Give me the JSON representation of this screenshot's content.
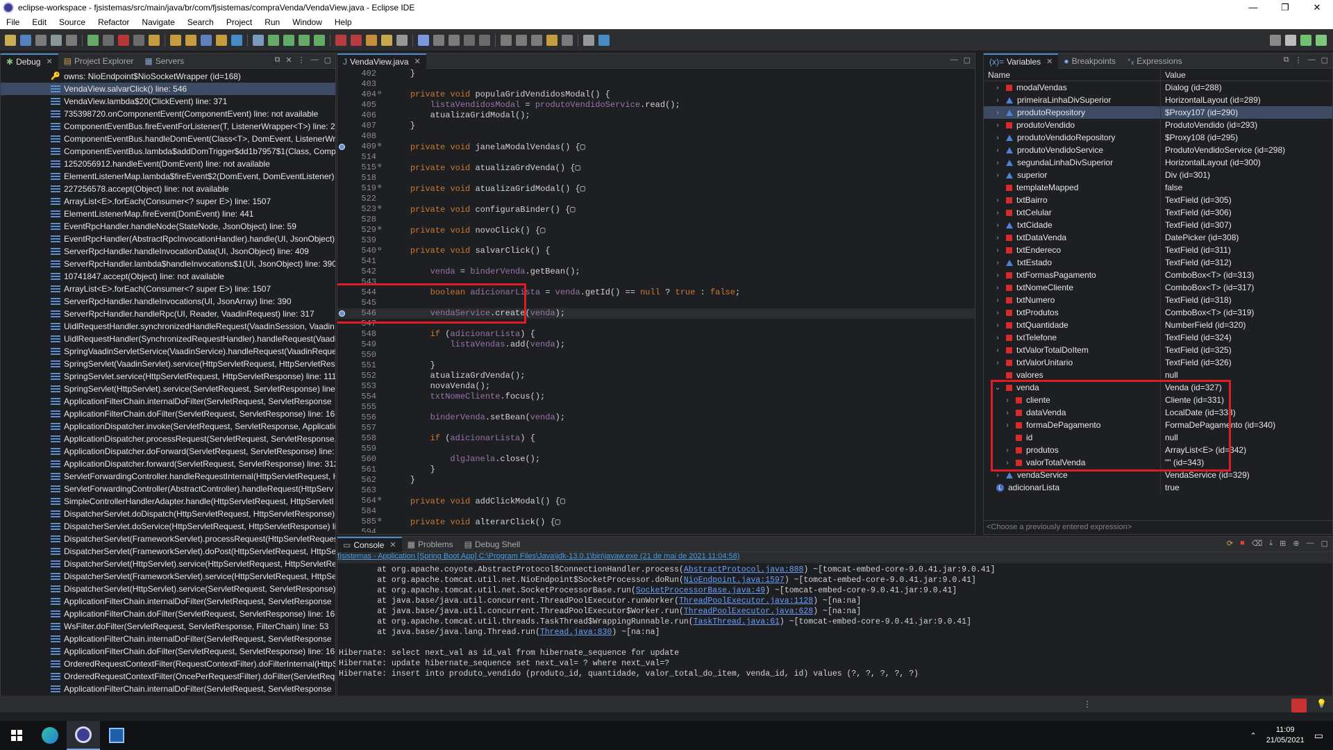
{
  "window": {
    "title": "eclipse-workspace - fjsistemas/src/main/java/br/com/fjsistemas/compraVenda/VendaView.java - Eclipse IDE"
  },
  "menu": [
    "File",
    "Edit",
    "Source",
    "Refactor",
    "Navigate",
    "Search",
    "Project",
    "Run",
    "Window",
    "Help"
  ],
  "debug_panel": {
    "tabs": [
      "Debug",
      "Project Explorer",
      "Servers"
    ],
    "frames": [
      {
        "label": "owns: NioEndpoint$NioSocketWrapper  (id=168)",
        "icon": "key"
      },
      {
        "label": "VendaView.salvarClick() line: 546",
        "selected": true
      },
      {
        "label": "VendaView.lambda$20(ClickEvent) line: 371"
      },
      {
        "label": "735398720.onComponentEvent(ComponentEvent) line: not available"
      },
      {
        "label": "ComponentEventBus.fireEventForListener(T, ListenerWrapper<T>) line: 20"
      },
      {
        "label": "ComponentEventBus.handleDomEvent(Class<T>, DomEvent, ListenerWr"
      },
      {
        "label": "ComponentEventBus.lambda$addDomTrigger$dd1b7957$1(Class, Compo"
      },
      {
        "label": "1252056912.handleEvent(DomEvent) line: not available"
      },
      {
        "label": "ElementListenerMap.lambda$fireEvent$2(DomEvent, DomEventListener)"
      },
      {
        "label": "227256578.accept(Object) line: not available"
      },
      {
        "label": "ArrayList<E>.forEach(Consumer<? super E>) line: 1507"
      },
      {
        "label": "ElementListenerMap.fireEvent(DomEvent) line: 441"
      },
      {
        "label": "EventRpcHandler.handleNode(StateNode, JsonObject) line: 59"
      },
      {
        "label": "EventRpcHandler(AbstractRpcInvocationHandler).handle(UI, JsonObject)"
      },
      {
        "label": "ServerRpcHandler.handleInvocationData(UI, JsonObject) line: 409"
      },
      {
        "label": "ServerRpcHandler.lambda$handleInvocations$1(UI, JsonObject) line: 390"
      },
      {
        "label": "10741847.accept(Object) line: not available"
      },
      {
        "label": "ArrayList<E>.forEach(Consumer<? super E>) line: 1507"
      },
      {
        "label": "ServerRpcHandler.handleInvocations(UI, JsonArray) line: 390"
      },
      {
        "label": "ServerRpcHandler.handleRpc(UI, Reader, VaadinRequest) line: 317"
      },
      {
        "label": "UidlRequestHandler.synchronizedHandleRequest(VaadinSession, Vaadin"
      },
      {
        "label": "UidlRequestHandler(SynchronizedRequestHandler).handleRequest(Vaadi"
      },
      {
        "label": "SpringVaadinServletService(VaadinService).handleRequest(VaadinRequest,"
      },
      {
        "label": "SpringServlet(VaadinServlet).service(HttpServletRequest, HttpServletResp"
      },
      {
        "label": "SpringServlet.service(HttpServletRequest, HttpServletResponse) line: 111"
      },
      {
        "label": "SpringServlet(HttpServlet).service(ServletRequest, ServletResponse) line: 7"
      },
      {
        "label": "ApplicationFilterChain.internalDoFilter(ServletRequest, ServletResponse"
      },
      {
        "label": "ApplicationFilterChain.doFilter(ServletRequest, ServletResponse) line: 166"
      },
      {
        "label": "ApplicationDispatcher.invoke(ServletRequest, ServletResponse, Applicatic"
      },
      {
        "label": "ApplicationDispatcher.processRequest(ServletRequest, ServletResponse, /"
      },
      {
        "label": "ApplicationDispatcher.doForward(ServletRequest, ServletResponse) line: 3"
      },
      {
        "label": "ApplicationDispatcher.forward(ServletRequest, ServletResponse) line: 312"
      },
      {
        "label": "ServletForwardingController.handleRequestInternal(HttpServletRequest, H"
      },
      {
        "label": "ServletForwardingController(AbstractController).handleRequest(HttpServ"
      },
      {
        "label": "SimpleControllerHandlerAdapter.handle(HttpServletRequest, HttpServletI"
      },
      {
        "label": "DispatcherServlet.doDispatch(HttpServletRequest, HttpServletResponse) l"
      },
      {
        "label": "DispatcherServlet.doService(HttpServletRequest, HttpServletResponse) lin"
      },
      {
        "label": "DispatcherServlet(FrameworkServlet).processRequest(HttpServletRequest,"
      },
      {
        "label": "DispatcherServlet(FrameworkServlet).doPost(HttpServletRequest, HttpSer"
      },
      {
        "label": "DispatcherServlet(HttpServlet).service(HttpServletRequest, HttpServletRes"
      },
      {
        "label": "DispatcherServlet(FrameworkServlet).service(HttpServletRequest, HttpSer"
      },
      {
        "label": "DispatcherServlet(HttpServlet).service(ServletRequest, ServletResponse) l"
      },
      {
        "label": "ApplicationFilterChain.internalDoFilter(ServletRequest, ServletResponse"
      },
      {
        "label": "ApplicationFilterChain.doFilter(ServletRequest, ServletResponse) line: 166"
      },
      {
        "label": "WsFilter.doFilter(ServletRequest, ServletResponse, FilterChain) line: 53"
      },
      {
        "label": "ApplicationFilterChain.internalDoFilter(ServletRequest, ServletResponse"
      },
      {
        "label": "ApplicationFilterChain.doFilter(ServletRequest, ServletResponse) line: 166"
      },
      {
        "label": "OrderedRequestContextFilter(RequestContextFilter).doFilterInternal(HttpS"
      },
      {
        "label": "OrderedRequestContextFilter(OncePerRequestFilter).doFilter(ServletRequ"
      },
      {
        "label": "ApplicationFilterChain.internalDoFilter(ServletRequest, ServletResponse"
      }
    ]
  },
  "editor": {
    "tab": "VendaView.java",
    "lines": [
      {
        "n": "402",
        "code": "    }",
        "fold": ""
      },
      {
        "n": "403",
        "code": "",
        "fold": ""
      },
      {
        "n": "404",
        "code": "    private void populaGridVendidosModal() {",
        "fold": "⊖"
      },
      {
        "n": "405",
        "code": "        listaVendidosModal = produtoVendidoService.read();",
        "fold": ""
      },
      {
        "n": "406",
        "code": "        atualizaGridModal();",
        "fold": ""
      },
      {
        "n": "407",
        "code": "    }",
        "fold": ""
      },
      {
        "n": "408",
        "code": "",
        "fold": ""
      },
      {
        "n": "409",
        "code": "    private void janelaModalVendas() {▢",
        "fold": "⊕",
        "bp": true
      },
      {
        "n": "514",
        "code": "",
        "fold": ""
      },
      {
        "n": "515",
        "code": "    private void atualizaGrdVenda() {▢",
        "fold": "⊕"
      },
      {
        "n": "518",
        "code": "",
        "fold": ""
      },
      {
        "n": "519",
        "code": "    private void atualizaGridModal() {▢",
        "fold": "⊕"
      },
      {
        "n": "522",
        "code": "",
        "fold": ""
      },
      {
        "n": "523",
        "code": "    private void configuraBinder() {▢",
        "fold": "⊕"
      },
      {
        "n": "528",
        "code": "",
        "fold": ""
      },
      {
        "n": "529",
        "code": "    private void novoClick() {▢",
        "fold": "⊕"
      },
      {
        "n": "539",
        "code": "",
        "fold": ""
      },
      {
        "n": "540",
        "code": "    private void salvarClick() {",
        "fold": "⊖"
      },
      {
        "n": "541",
        "code": "",
        "fold": ""
      },
      {
        "n": "542",
        "code": "        venda = binderVenda.getBean();",
        "fold": ""
      },
      {
        "n": "543",
        "code": "",
        "fold": ""
      },
      {
        "n": "544",
        "code": "        boolean adicionarLista = venda.getId() == null ? true : false;",
        "fold": ""
      },
      {
        "n": "545",
        "code": "",
        "fold": ""
      },
      {
        "n": "546",
        "code": "        vendaService.create(venda);",
        "fold": "",
        "bp": true,
        "current": true
      },
      {
        "n": "547",
        "code": "",
        "fold": ""
      },
      {
        "n": "548",
        "code": "        if (adicionarLista) {",
        "fold": ""
      },
      {
        "n": "549",
        "code": "            listaVendas.add(venda);",
        "fold": ""
      },
      {
        "n": "550",
        "code": "",
        "fold": ""
      },
      {
        "n": "551",
        "code": "        }",
        "fold": ""
      },
      {
        "n": "552",
        "code": "        atualizaGrdVenda();",
        "fold": ""
      },
      {
        "n": "553",
        "code": "        novaVenda();",
        "fold": ""
      },
      {
        "n": "554",
        "code": "        txtNomeCliente.focus();",
        "fold": ""
      },
      {
        "n": "555",
        "code": "",
        "fold": ""
      },
      {
        "n": "556",
        "code": "        binderVenda.setBean(venda);",
        "fold": ""
      },
      {
        "n": "557",
        "code": "",
        "fold": ""
      },
      {
        "n": "558",
        "code": "        if (adicionarLista) {",
        "fold": ""
      },
      {
        "n": "559",
        "code": "",
        "fold": ""
      },
      {
        "n": "560",
        "code": "            dlgJanela.close();",
        "fold": ""
      },
      {
        "n": "561",
        "code": "        }",
        "fold": ""
      },
      {
        "n": "562",
        "code": "    }",
        "fold": ""
      },
      {
        "n": "563",
        "code": "",
        "fold": ""
      },
      {
        "n": "564",
        "code": "    private void addClickModal() {▢",
        "fold": "⊕"
      },
      {
        "n": "584",
        "code": "",
        "fold": ""
      },
      {
        "n": "585",
        "code": "    private void alterarClick() {▢",
        "fold": "⊕"
      },
      {
        "n": "594",
        "code": "",
        "fold": ""
      }
    ]
  },
  "variables": {
    "tabs": [
      "Variables",
      "Breakpoints",
      "Expressions"
    ],
    "col_name": "Name",
    "col_value": "Value",
    "rows": [
      {
        "name": "modalVendas",
        "value": "Dialog  (id=288)",
        "icon": "red",
        "depth": 1,
        "chev": "›"
      },
      {
        "name": "primeiraLinhaDivSuperior",
        "value": "HorizontalLayout  (id=289)",
        "icon": "tri",
        "depth": 1,
        "chev": "›"
      },
      {
        "name": "produtoRepository",
        "value": "$Proxy107  (id=290)",
        "icon": "tri",
        "depth": 1,
        "chev": "›",
        "selected": true
      },
      {
        "name": "produtoVendido",
        "value": "ProdutoVendido  (id=293)",
        "icon": "red",
        "depth": 1,
        "chev": "›"
      },
      {
        "name": "produtoVendidoRepository",
        "value": "$Proxy108  (id=295)",
        "icon": "tri",
        "depth": 1,
        "chev": "›"
      },
      {
        "name": "produtoVendidoService",
        "value": "ProdutoVendidoService  (id=298)",
        "icon": "tri",
        "depth": 1,
        "chev": "›"
      },
      {
        "name": "segundaLinhaDivSuperior",
        "value": "HorizontalLayout  (id=300)",
        "icon": "tri",
        "depth": 1,
        "chev": "›"
      },
      {
        "name": "superior",
        "value": "Div  (id=301)",
        "icon": "tri",
        "depth": 1,
        "chev": "›"
      },
      {
        "name": "templateMapped",
        "value": "false",
        "icon": "red",
        "depth": 1,
        "chev": ""
      },
      {
        "name": "txtBairro",
        "value": "TextField  (id=305)",
        "icon": "red",
        "depth": 1,
        "chev": "›"
      },
      {
        "name": "txtCelular",
        "value": "TextField  (id=306)",
        "icon": "red",
        "depth": 1,
        "chev": "›"
      },
      {
        "name": "txtCidade",
        "value": "TextField  (id=307)",
        "icon": "tri",
        "depth": 1,
        "chev": "›"
      },
      {
        "name": "txtDataVenda",
        "value": "DatePicker  (id=308)",
        "icon": "red",
        "depth": 1,
        "chev": "›"
      },
      {
        "name": "txtEndereco",
        "value": "TextField  (id=311)",
        "icon": "red",
        "depth": 1,
        "chev": "›"
      },
      {
        "name": "txtEstado",
        "value": "TextField  (id=312)",
        "icon": "tri",
        "depth": 1,
        "chev": "›"
      },
      {
        "name": "txtFormasPagamento",
        "value": "ComboBox<T>  (id=313)",
        "icon": "red",
        "depth": 1,
        "chev": "›"
      },
      {
        "name": "txtNomeCliente",
        "value": "ComboBox<T>  (id=317)",
        "icon": "red",
        "depth": 1,
        "chev": "›"
      },
      {
        "name": "txtNumero",
        "value": "TextField  (id=318)",
        "icon": "red",
        "depth": 1,
        "chev": "›"
      },
      {
        "name": "txtProdutos",
        "value": "ComboBox<T>  (id=319)",
        "icon": "red",
        "depth": 1,
        "chev": "›"
      },
      {
        "name": "txtQuantidade",
        "value": "NumberField  (id=320)",
        "icon": "red",
        "depth": 1,
        "chev": "›"
      },
      {
        "name": "txtTelefone",
        "value": "TextField  (id=324)",
        "icon": "red",
        "depth": 1,
        "chev": "›"
      },
      {
        "name": "txtValorTotalDoItem",
        "value": "TextField  (id=325)",
        "icon": "red",
        "depth": 1,
        "chev": "›"
      },
      {
        "name": "txtValorUnitario",
        "value": "TextField  (id=326)",
        "icon": "red",
        "depth": 1,
        "chev": "›"
      },
      {
        "name": "valores",
        "value": "null",
        "icon": "red",
        "depth": 1,
        "chev": ""
      },
      {
        "name": "venda",
        "value": "Venda  (id=327)",
        "icon": "red",
        "depth": 1,
        "chev": "⌄"
      },
      {
        "name": "cliente",
        "value": "Cliente  (id=331)",
        "icon": "red",
        "depth": 2,
        "chev": "›"
      },
      {
        "name": "dataVenda",
        "value": "LocalDate  (id=333)",
        "icon": "red",
        "depth": 2,
        "chev": "›"
      },
      {
        "name": "formaDePagamento",
        "value": "FormaDePagamento  (id=340)",
        "icon": "red",
        "depth": 2,
        "chev": "›"
      },
      {
        "name": "id",
        "value": "null",
        "icon": "red",
        "depth": 2,
        "chev": ""
      },
      {
        "name": "produtos",
        "value": "ArrayList<E>  (id=342)",
        "icon": "red",
        "depth": 2,
        "chev": "›"
      },
      {
        "name": "valorTotalVenda",
        "value": "\"\" (id=343)",
        "icon": "red",
        "depth": 2,
        "chev": "›"
      },
      {
        "name": "vendaService",
        "value": "VendaService  (id=329)",
        "icon": "tri",
        "depth": 1,
        "chev": "›"
      },
      {
        "name": "adicionarLista",
        "value": "true",
        "icon": "lv",
        "depth": 0,
        "chev": ""
      }
    ],
    "expression_placeholder": "<Choose a previously entered expression>"
  },
  "console": {
    "tabs": [
      "Console",
      "Problems",
      "Debug Shell"
    ],
    "launch": "fjsistemas - Application [Spring Boot App] C:\\Program Files\\Java\\jdk-13.0.1\\bin\\javaw.exe  (21 de mai de 2021 11:04:58)",
    "lines": [
      {
        "pre": "        at org.apache.coyote.AbstractProtocol$ConnectionHandler.process(",
        "link": "AbstractProtocol.java:888",
        "post": ") ~[tomcat-embed-core-9.0.41.jar:9.0.41]"
      },
      {
        "pre": "        at org.apache.tomcat.util.net.NioEndpoint$SocketProcessor.doRun(",
        "link": "NioEndpoint.java:1597",
        "post": ") ~[tomcat-embed-core-9.0.41.jar:9.0.41]"
      },
      {
        "pre": "        at org.apache.tomcat.util.net.SocketProcessorBase.run(",
        "link": "SocketProcessorBase.java:49",
        "post": ") ~[tomcat-embed-core-9.0.41.jar:9.0.41]"
      },
      {
        "pre": "        at java.base/java.util.concurrent.ThreadPoolExecutor.runWorker(",
        "link": "ThreadPoolExecutor.java:1128",
        "post": ") ~[na:na]"
      },
      {
        "pre": "        at java.base/java.util.concurrent.ThreadPoolExecutor$Worker.run(",
        "link": "ThreadPoolExecutor.java:628",
        "post": ") ~[na:na]"
      },
      {
        "pre": "        at org.apache.tomcat.util.threads.TaskThread$WrappingRunnable.run(",
        "link": "TaskThread.java:61",
        "post": ") ~[tomcat-embed-core-9.0.41.jar:9.0.41]"
      },
      {
        "pre": "        at java.base/java.lang.Thread.run(",
        "link": "Thread.java:830",
        "post": ") ~[na:na]"
      },
      {
        "pre": "",
        "link": "",
        "post": ""
      },
      {
        "pre": "Hibernate: select next_val as id_val from hibernate_sequence for update",
        "link": "",
        "post": ""
      },
      {
        "pre": "Hibernate: update hibernate_sequence set next_val= ? where next_val=?",
        "link": "",
        "post": ""
      },
      {
        "pre": "Hibernate: insert into produto_vendido (produto_id, quantidade, valor_total_do_item, venda_id, id) values (?, ?, ?, ?, ?)",
        "link": "",
        "post": ""
      }
    ]
  },
  "taskbar": {
    "time": "11:09",
    "date": "21/05/2021"
  },
  "colors": {
    "highlight_box": "#e01b24",
    "selection": "#3d4a63",
    "field_icon": "#d72b2b",
    "accent": "#4a88c7"
  }
}
